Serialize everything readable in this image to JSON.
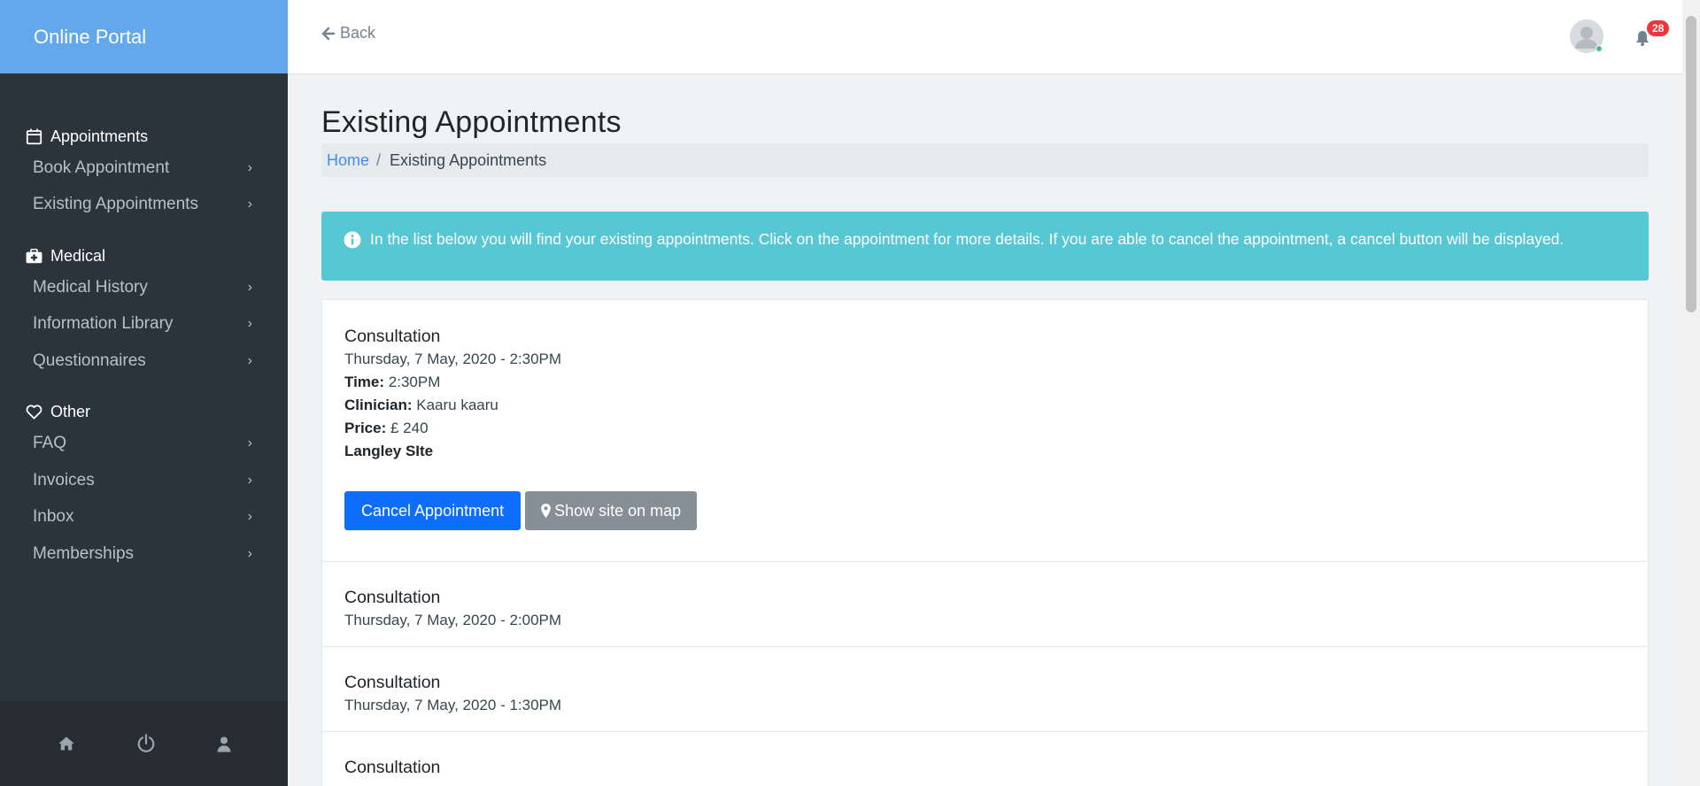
{
  "brand": "Online Portal",
  "topbar": {
    "back_label": "Back",
    "notification_count": "28"
  },
  "nav": {
    "groups": [
      {
        "title": "Appointments",
        "items": [
          "Book Appointment",
          "Existing Appointments"
        ]
      },
      {
        "title": "Medical",
        "items": [
          "Medical History",
          "Information Library",
          "Questionnaires"
        ]
      },
      {
        "title": "Other",
        "items": [
          "FAQ",
          "Invoices",
          "Inbox",
          "Memberships"
        ]
      }
    ]
  },
  "page": {
    "title": "Existing Appointments",
    "breadcrumb_home": "Home",
    "breadcrumb_sep": "/",
    "breadcrumb_current": "Existing Appointments",
    "info": "In the list below you will find your existing appointments. Click on the appointment for more details. If you are able to cancel the appointment, a cancel button will be displayed."
  },
  "appointments": [
    {
      "title": "Consultation",
      "datetime": "Thursday, 7 May, 2020 - 2:30PM",
      "time_label": "Time:",
      "time": "2:30PM",
      "clinician_label": "Clinician:",
      "clinician": "Kaaru kaaru",
      "price_label": "Price:",
      "price": "£ 240",
      "site": "Langley SIte",
      "cancel_label": "Cancel Appointment",
      "map_label": "Show site on map"
    },
    {
      "title": "Consultation",
      "datetime": "Thursday, 7 May, 2020 - 2:00PM"
    },
    {
      "title": "Consultation",
      "datetime": "Thursday, 7 May, 2020 - 1:30PM"
    },
    {
      "title": "Consultation"
    }
  ],
  "colors": {
    "sidebar": "#2b343b",
    "brand": "#62a8ea",
    "info": "#57c7d4",
    "primary": "#0d6efd",
    "secondary": "#868e96",
    "badge": "#f2353c"
  }
}
